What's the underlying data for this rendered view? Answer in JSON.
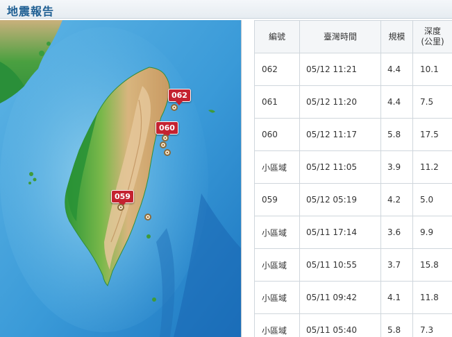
{
  "header": {
    "title": "地震報告"
  },
  "map": {
    "markers": [
      {
        "label": "062",
        "color": "#c42230"
      },
      {
        "label": "059",
        "color": "#c42230"
      },
      {
        "label": "060",
        "color": "#c42230"
      }
    ],
    "colors": {
      "sea_deep": "#1f7fc8",
      "sea_shallow": "#62b6e6",
      "lowland": "#2f9a3c",
      "highland": "#d9b07a"
    }
  },
  "table": {
    "headers": {
      "id": "編號",
      "time": "臺灣時間",
      "magnitude": "規模",
      "depth_line1": "深度",
      "depth_line2": "(公里)"
    },
    "rows": [
      {
        "id": "062",
        "time": "05/12 11:21",
        "magnitude": "4.4",
        "depth": "10.1"
      },
      {
        "id": "061",
        "time": "05/12 11:20",
        "magnitude": "4.4",
        "depth": "7.5"
      },
      {
        "id": "060",
        "time": "05/12 11:17",
        "magnitude": "5.8",
        "depth": "17.5"
      },
      {
        "id": "小區域",
        "time": "05/12 11:05",
        "magnitude": "3.9",
        "depth": "11.2"
      },
      {
        "id": "059",
        "time": "05/12 05:19",
        "magnitude": "4.2",
        "depth": "5.0"
      },
      {
        "id": "小區域",
        "time": "05/11 17:14",
        "magnitude": "3.6",
        "depth": "9.9"
      },
      {
        "id": "小區域",
        "time": "05/11 10:55",
        "magnitude": "3.7",
        "depth": "15.8"
      },
      {
        "id": "小區域",
        "time": "05/11 09:42",
        "magnitude": "4.1",
        "depth": "11.8"
      },
      {
        "id": "小區域",
        "time": "05/11 05:40",
        "magnitude": "5.8",
        "depth": "7.3"
      }
    ]
  }
}
